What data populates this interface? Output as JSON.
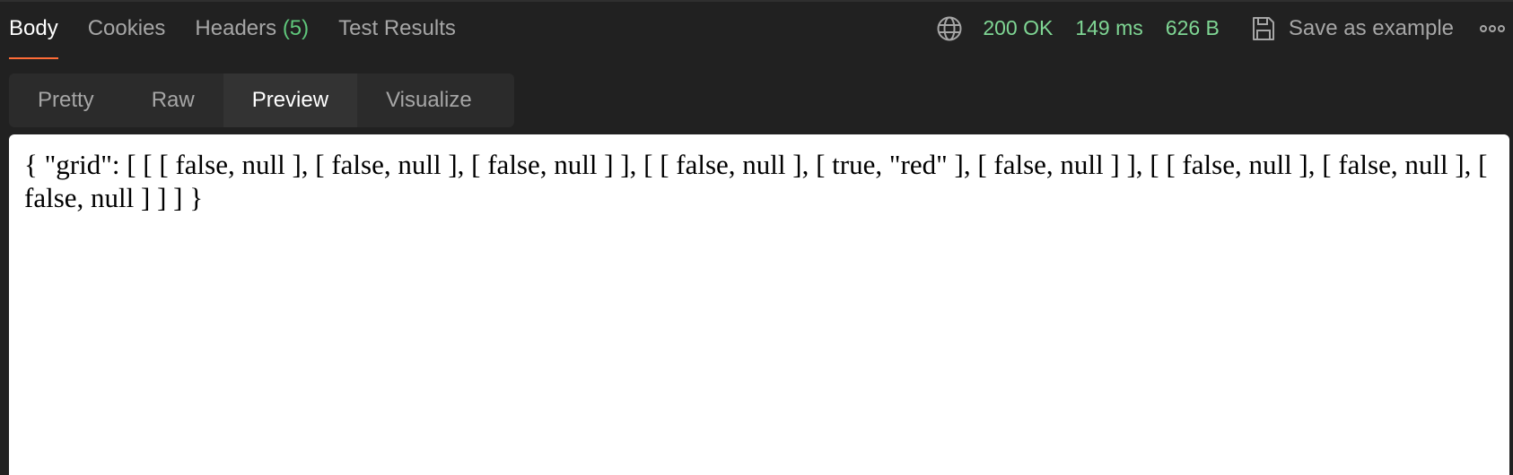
{
  "response_tabs": [
    {
      "label": "Body",
      "active": true
    },
    {
      "label": "Cookies",
      "active": false
    },
    {
      "label": "Headers",
      "count": "(5)",
      "active": false
    },
    {
      "label": "Test Results",
      "active": false
    }
  ],
  "status_bar": {
    "status": "200 OK",
    "time": "149 ms",
    "size": "626 B",
    "save_label": "Save as example",
    "status_color": "#7fd694",
    "icons": [
      "globe-icon",
      "save-icon",
      "more-icon"
    ]
  },
  "view_modes": [
    {
      "label": "Pretty",
      "active": false
    },
    {
      "label": "Raw",
      "active": false
    },
    {
      "label": "Preview",
      "active": true
    },
    {
      "label": "Visualize",
      "active": false
    }
  ],
  "preview": {
    "content": "{ \"grid\": [ [ [ false, null ], [ false, null ], [ false, null ] ], [ [ false, null ], [ true, \"red\" ], [ false, null ] ], [ [ false, null ], [ false, null ], [ false, null ] ] ] }"
  },
  "colors": {
    "background": "#212121",
    "accent": "#ff6c37",
    "header_count": "#5fc77b"
  }
}
